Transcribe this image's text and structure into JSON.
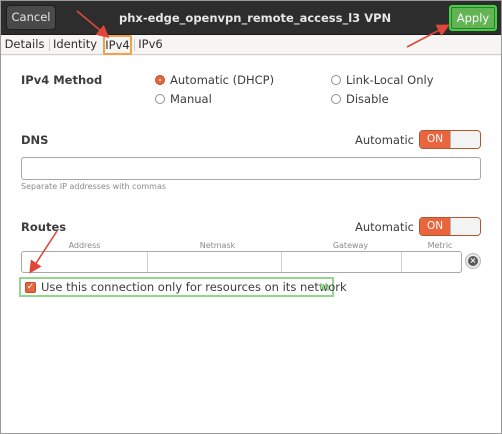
{
  "header": {
    "cancel_label": "Cancel",
    "title": "phx-edge_openvpn_remote_access_l3 VPN",
    "apply_label": "Apply"
  },
  "tabs": [
    {
      "label": "Details"
    },
    {
      "label": "Identity"
    },
    {
      "label": "IPv4",
      "selected": true
    },
    {
      "label": "IPv6"
    }
  ],
  "ipv4_method": {
    "label": "IPv4 Method",
    "options": [
      {
        "label": "Automatic (DHCP)",
        "checked": true
      },
      {
        "label": "Link-Local Only",
        "checked": false
      },
      {
        "label": "Manual",
        "checked": false
      },
      {
        "label": "Disable",
        "checked": false
      }
    ]
  },
  "dns": {
    "label": "DNS",
    "automatic_label": "Automatic",
    "switch_label": "ON",
    "value": "",
    "hint": "Separate IP addresses with commas"
  },
  "routes": {
    "label": "Routes",
    "automatic_label": "Automatic",
    "switch_label": "ON",
    "columns": [
      "Address",
      "Netmask",
      "Gateway",
      "Metric"
    ]
  },
  "only_resources": {
    "label": "Use this connection only for resources on its network",
    "checked": true
  },
  "colors": {
    "accent": "#e9653d",
    "apply": "#64b456",
    "header": "#2d2d2d",
    "annotation_arrow": "#e0473a",
    "annotation_box": "#95d68e"
  },
  "icons": [
    "checkmark-icon",
    "remove-icon",
    "spinner-icon"
  ]
}
